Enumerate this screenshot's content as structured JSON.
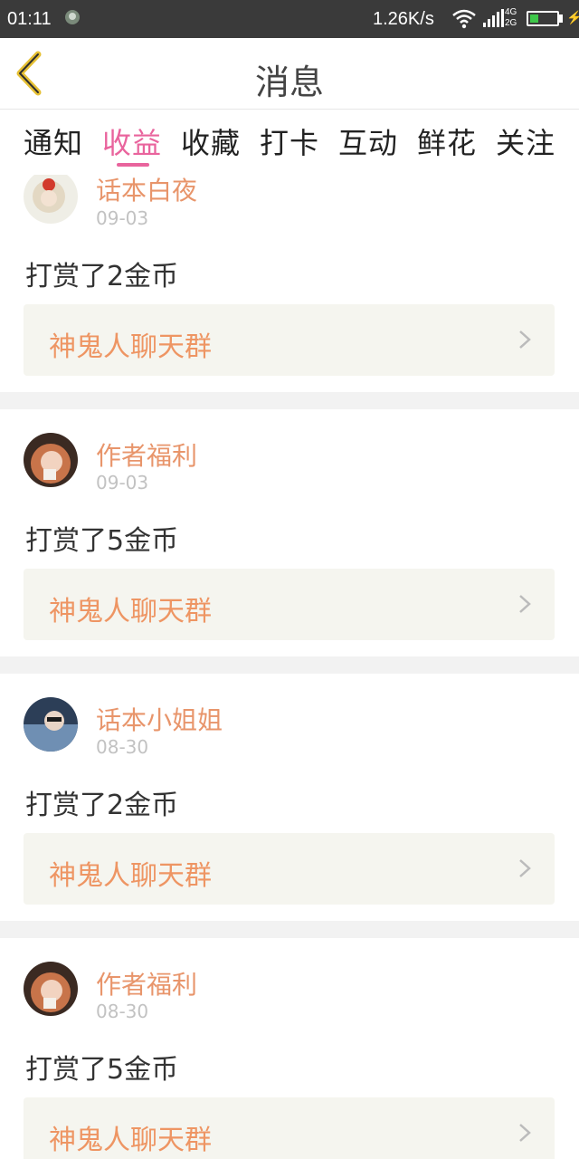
{
  "status_bar": {
    "time": "01:11",
    "net_speed": "1.26K/s",
    "net_type_1": "4G",
    "net_type_2": "2G"
  },
  "header": {
    "title": "消息",
    "back_icon": "chevron-left-icon"
  },
  "tabs": [
    {
      "label": "通知",
      "active": false
    },
    {
      "label": "收益",
      "active": true
    },
    {
      "label": "收藏",
      "active": false
    },
    {
      "label": "打卡",
      "active": false
    },
    {
      "label": "互动",
      "active": false
    },
    {
      "label": "鲜花",
      "active": false
    },
    {
      "label": "关注",
      "active": false
    }
  ],
  "colors": {
    "accent": "#e9649d",
    "name": "#e8956b",
    "group": "#ee9563"
  },
  "messages": [
    {
      "sender": "话本白夜",
      "date": "09-03",
      "text": "打赏了2金币",
      "group": "神鬼人聊天群"
    },
    {
      "sender": "作者福利",
      "date": "09-03",
      "text": "打赏了5金币",
      "group": "神鬼人聊天群"
    },
    {
      "sender": "话本小姐姐",
      "date": "08-30",
      "text": "打赏了2金币",
      "group": "神鬼人聊天群"
    },
    {
      "sender": "作者福利",
      "date": "08-30",
      "text": "打赏了5金币",
      "group": "神鬼人聊天群"
    }
  ]
}
